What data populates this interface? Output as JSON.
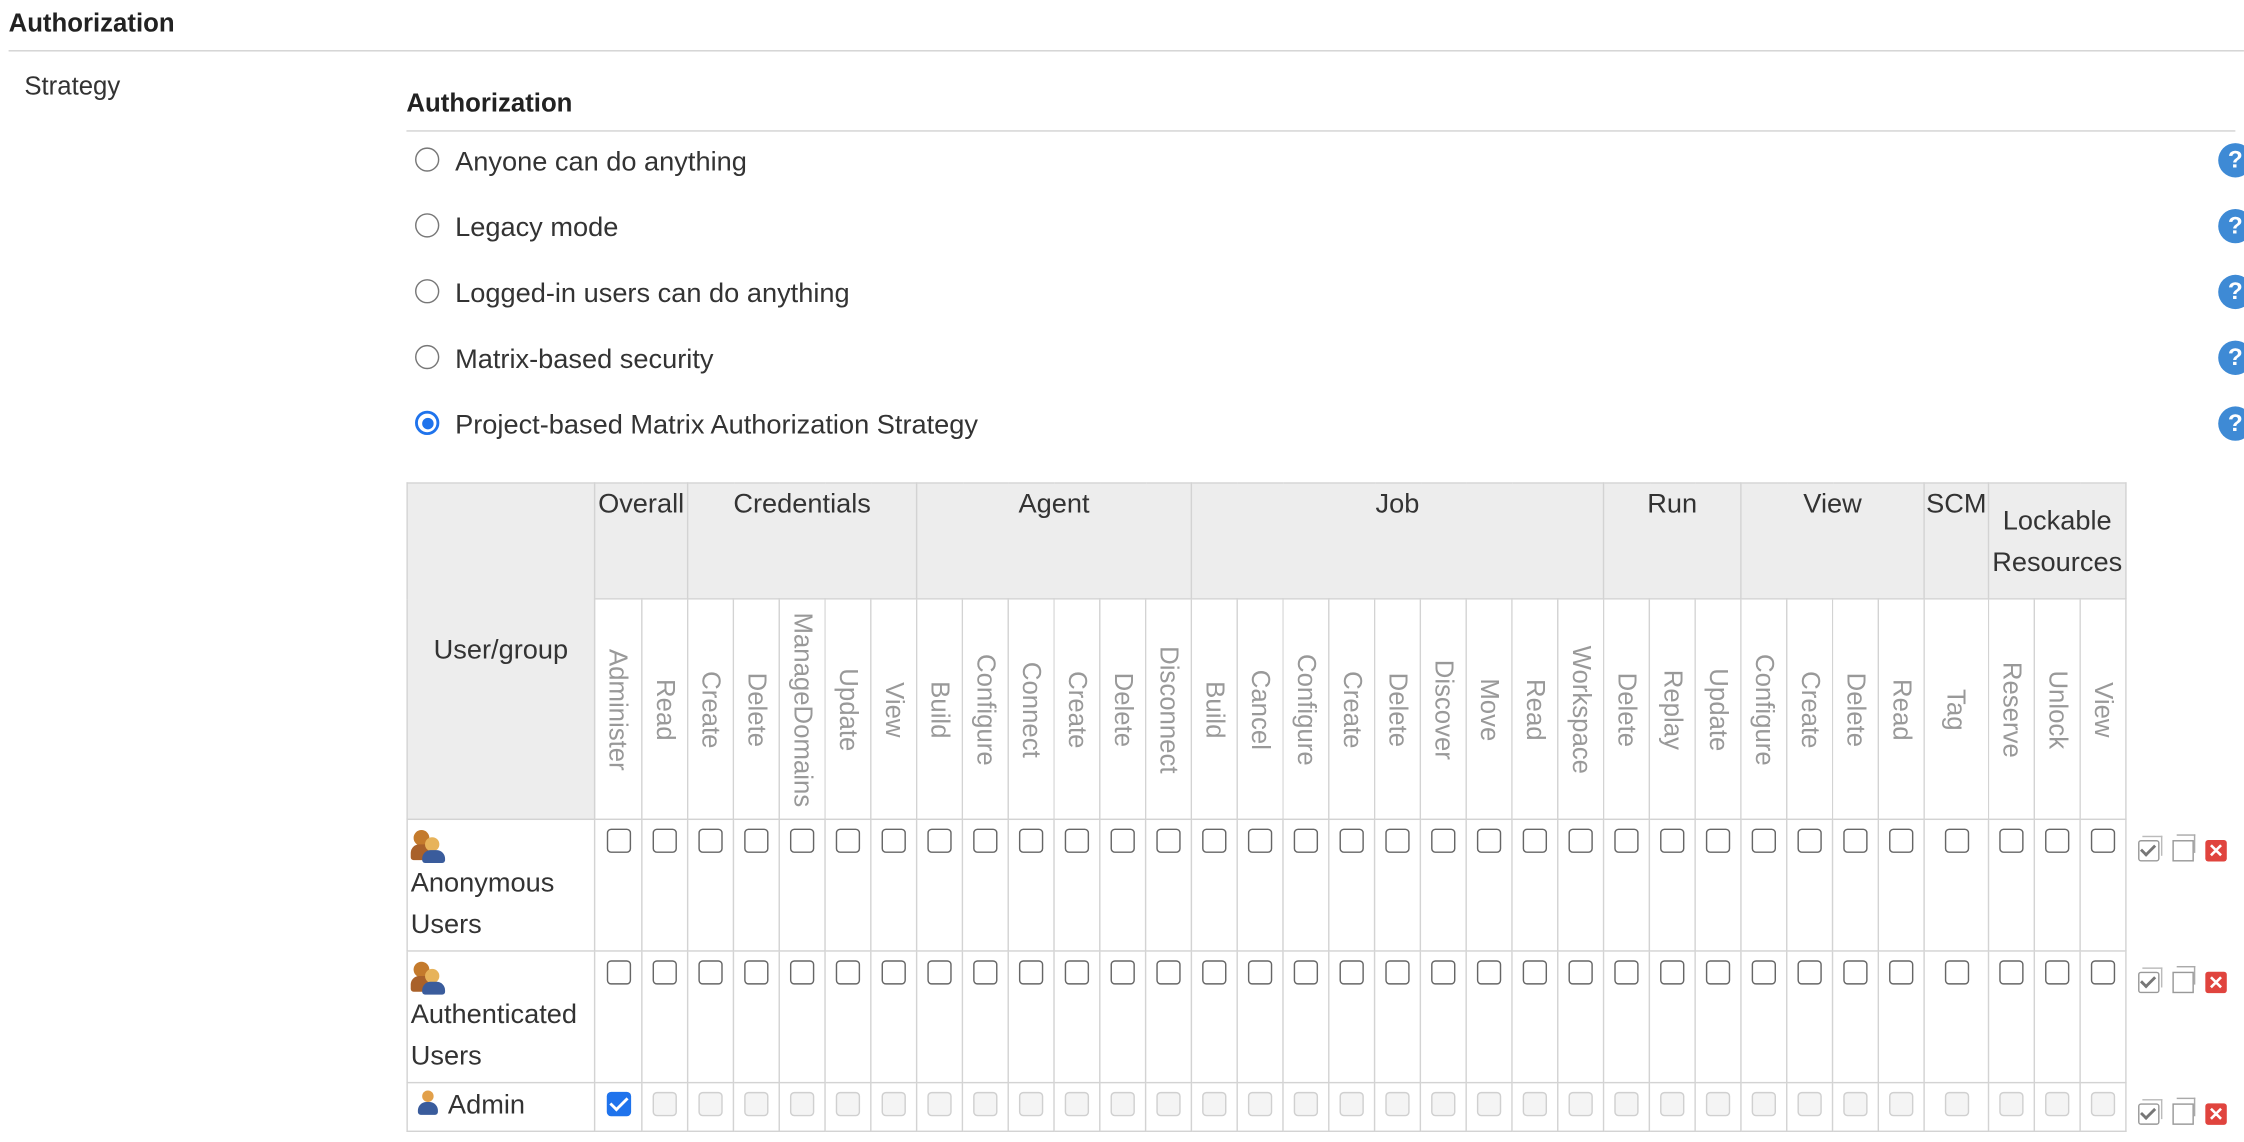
{
  "section": {
    "title": "Authorization"
  },
  "strategy_label": "Strategy",
  "authorization": {
    "title": "Authorization",
    "options": [
      {
        "label": "Anyone can do anything",
        "selected": false
      },
      {
        "label": "Legacy mode",
        "selected": false
      },
      {
        "label": "Logged-in users can do anything",
        "selected": false
      },
      {
        "label": "Matrix-based security",
        "selected": false
      },
      {
        "label": "Project-based Matrix Authorization Strategy",
        "selected": true
      }
    ],
    "help_symbol": "?"
  },
  "matrix": {
    "user_group_header": "User/group",
    "groups": [
      {
        "label": "Overall",
        "permissions": [
          "Administer",
          "Read"
        ]
      },
      {
        "label": "Credentials",
        "permissions": [
          "Create",
          "Delete",
          "ManageDomains",
          "Update",
          "View"
        ]
      },
      {
        "label": "Agent",
        "permissions": [
          "Build",
          "Configure",
          "Connect",
          "Create",
          "Delete",
          "Disconnect"
        ]
      },
      {
        "label": "Job",
        "permissions": [
          "Build",
          "Cancel",
          "Configure",
          "Create",
          "Delete",
          "Discover",
          "Move",
          "Read",
          "Workspace"
        ]
      },
      {
        "label": "Run",
        "permissions": [
          "Delete",
          "Replay",
          "Update"
        ]
      },
      {
        "label": "View",
        "permissions": [
          "Configure",
          "Create",
          "Delete",
          "Read"
        ]
      },
      {
        "label": "SCM",
        "permissions": [
          "Tag"
        ]
      },
      {
        "label": "Lockable Resources",
        "permissions": [
          "Reserve",
          "Unlock",
          "View"
        ]
      }
    ],
    "rows": [
      {
        "name": "Anonymous Users",
        "icon": "group-icon",
        "administer_checked": false,
        "others_disabled": false
      },
      {
        "name": "Authenticated Users",
        "icon": "group-icon",
        "administer_checked": false,
        "others_disabled": false
      },
      {
        "name": "Admin",
        "icon": "user-icon",
        "administer_checked": true,
        "others_disabled": true
      }
    ],
    "row_actions": [
      "select-all-icon",
      "copy-icon",
      "delete-icon"
    ],
    "delete_symbol": "✕"
  }
}
